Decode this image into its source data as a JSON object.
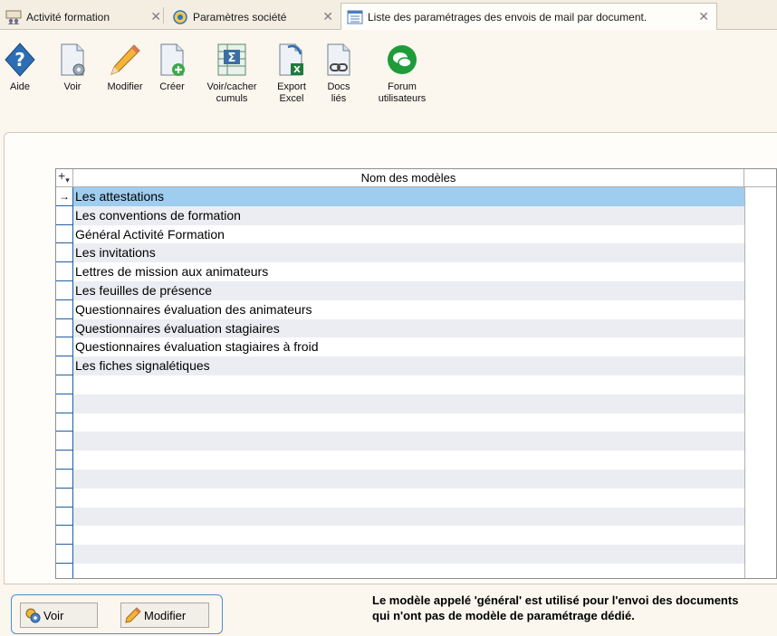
{
  "tabs": [
    {
      "label": "Activité formation",
      "icon": "training-icon"
    },
    {
      "label": "Paramètres société",
      "icon": "company-settings-icon"
    },
    {
      "label": "Liste des paramétrages des envois de mail par document.",
      "icon": "list-window-icon"
    }
  ],
  "toolbar": {
    "aide": "Aide",
    "voir": "Voir",
    "modifier": "Modifier",
    "creer": "Créer",
    "cumuls_1": "Voir/cacher",
    "cumuls_2": "cumuls",
    "export_1": "Export",
    "export_2": "Excel",
    "docs_1": "Docs",
    "docs_2": "liés",
    "forum_1": "Forum",
    "forum_2": "utilisateurs"
  },
  "grid": {
    "corner": "+",
    "column_header": "Nom des modèles",
    "selected_marker": "→",
    "rows": [
      "Les attestations",
      "Les conventions de formation",
      "Général Activité Formation",
      "Les invitations",
      "Lettres de mission aux animateurs",
      "Les feuilles de présence",
      "Questionnaires évaluation des animateurs",
      "Questionnaires évaluation stagiaires",
      "Questionnaires évaluation stagiaires à froid",
      "Les fiches signalétiques",
      "",
      "",
      "",
      "",
      "",
      "",
      "",
      "",
      "",
      "",
      ""
    ]
  },
  "bottom": {
    "voir": "Voir",
    "modifier": "Modifier",
    "note_line1": "Le modèle appelé 'général' est utilisé pour l'envoi des documents",
    "note_line2": "qui n'ont pas de modèle de paramétrage dédié."
  },
  "colors": {
    "selected_row": "#9fcdef",
    "alt_row": "#ebedf2",
    "accent_border": "#4a8fd0"
  }
}
